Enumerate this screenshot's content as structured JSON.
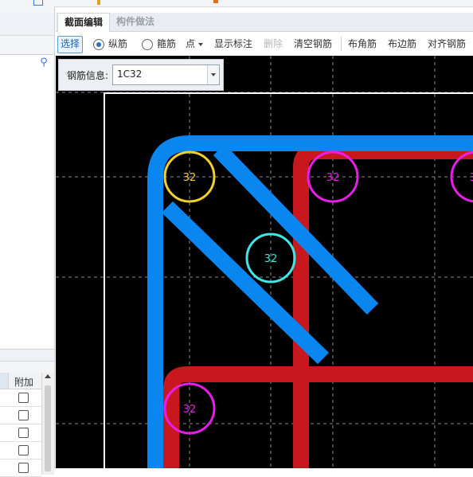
{
  "tabs": [
    {
      "label": "截面编辑",
      "active": true
    },
    {
      "label": "构件做法",
      "active": false
    }
  ],
  "toolbar": {
    "select": "选择",
    "longitudinal": "纵筋",
    "stirrup": "箍筋",
    "point": "点",
    "show_annotation": "显示标注",
    "delete": "删除",
    "clear_rebar": "清空钢筋",
    "corner_rebar": "布角筋",
    "edge_rebar": "布边筋",
    "align_rebar": "对齐钢筋",
    "mode_selected": "纵筋"
  },
  "rebar_info": {
    "label": "钢筋信息:",
    "value": "1C32"
  },
  "left_panel": {
    "grid_column": "附加",
    "search_icon": "search-icon"
  },
  "canvas": {
    "bars": [
      {
        "label": "32",
        "color": "#f2d12a",
        "kind": "corner"
      },
      {
        "label": "32",
        "color": "#e81ee8",
        "kind": "edge-top"
      },
      {
        "label": "32",
        "color": "#e81ee8",
        "kind": "edge-top-right"
      },
      {
        "label": "32",
        "color": "#3ee8e8",
        "kind": "inner"
      },
      {
        "label": "32",
        "color": "#e81ee8",
        "kind": "edge-left"
      }
    ],
    "colors": {
      "background": "#000000",
      "stirrup_outer": "#0a86f0",
      "stirrup_inner": "#c8181e",
      "section_border": "#ffffff",
      "guide_lines": "#8a8a8a"
    }
  }
}
